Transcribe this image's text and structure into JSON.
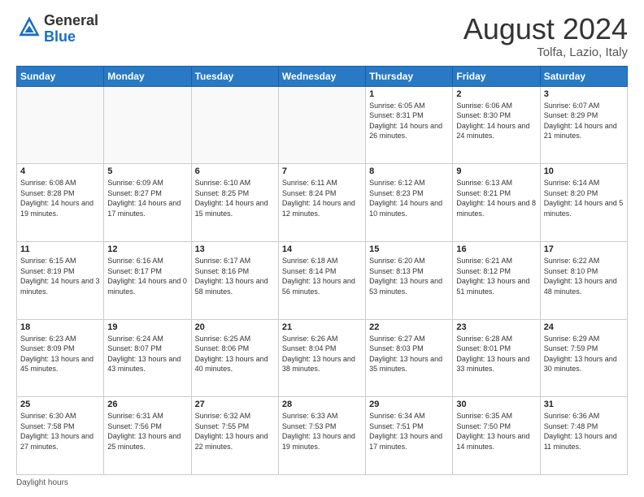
{
  "header": {
    "logo_general": "General",
    "logo_blue": "Blue",
    "title": "August 2024",
    "location": "Tolfa, Lazio, Italy"
  },
  "days_of_week": [
    "Sunday",
    "Monday",
    "Tuesday",
    "Wednesday",
    "Thursday",
    "Friday",
    "Saturday"
  ],
  "weeks": [
    [
      {
        "day": "",
        "detail": ""
      },
      {
        "day": "",
        "detail": ""
      },
      {
        "day": "",
        "detail": ""
      },
      {
        "day": "",
        "detail": ""
      },
      {
        "day": "1",
        "detail": "Sunrise: 6:05 AM\nSunset: 8:31 PM\nDaylight: 14 hours and 26 minutes."
      },
      {
        "day": "2",
        "detail": "Sunrise: 6:06 AM\nSunset: 8:30 PM\nDaylight: 14 hours and 24 minutes."
      },
      {
        "day": "3",
        "detail": "Sunrise: 6:07 AM\nSunset: 8:29 PM\nDaylight: 14 hours and 21 minutes."
      }
    ],
    [
      {
        "day": "4",
        "detail": "Sunrise: 6:08 AM\nSunset: 8:28 PM\nDaylight: 14 hours and 19 minutes."
      },
      {
        "day": "5",
        "detail": "Sunrise: 6:09 AM\nSunset: 8:27 PM\nDaylight: 14 hours and 17 minutes."
      },
      {
        "day": "6",
        "detail": "Sunrise: 6:10 AM\nSunset: 8:25 PM\nDaylight: 14 hours and 15 minutes."
      },
      {
        "day": "7",
        "detail": "Sunrise: 6:11 AM\nSunset: 8:24 PM\nDaylight: 14 hours and 12 minutes."
      },
      {
        "day": "8",
        "detail": "Sunrise: 6:12 AM\nSunset: 8:23 PM\nDaylight: 14 hours and 10 minutes."
      },
      {
        "day": "9",
        "detail": "Sunrise: 6:13 AM\nSunset: 8:21 PM\nDaylight: 14 hours and 8 minutes."
      },
      {
        "day": "10",
        "detail": "Sunrise: 6:14 AM\nSunset: 8:20 PM\nDaylight: 14 hours and 5 minutes."
      }
    ],
    [
      {
        "day": "11",
        "detail": "Sunrise: 6:15 AM\nSunset: 8:19 PM\nDaylight: 14 hours and 3 minutes."
      },
      {
        "day": "12",
        "detail": "Sunrise: 6:16 AM\nSunset: 8:17 PM\nDaylight: 14 hours and 0 minutes."
      },
      {
        "day": "13",
        "detail": "Sunrise: 6:17 AM\nSunset: 8:16 PM\nDaylight: 13 hours and 58 minutes."
      },
      {
        "day": "14",
        "detail": "Sunrise: 6:18 AM\nSunset: 8:14 PM\nDaylight: 13 hours and 56 minutes."
      },
      {
        "day": "15",
        "detail": "Sunrise: 6:20 AM\nSunset: 8:13 PM\nDaylight: 13 hours and 53 minutes."
      },
      {
        "day": "16",
        "detail": "Sunrise: 6:21 AM\nSunset: 8:12 PM\nDaylight: 13 hours and 51 minutes."
      },
      {
        "day": "17",
        "detail": "Sunrise: 6:22 AM\nSunset: 8:10 PM\nDaylight: 13 hours and 48 minutes."
      }
    ],
    [
      {
        "day": "18",
        "detail": "Sunrise: 6:23 AM\nSunset: 8:09 PM\nDaylight: 13 hours and 45 minutes."
      },
      {
        "day": "19",
        "detail": "Sunrise: 6:24 AM\nSunset: 8:07 PM\nDaylight: 13 hours and 43 minutes."
      },
      {
        "day": "20",
        "detail": "Sunrise: 6:25 AM\nSunset: 8:06 PM\nDaylight: 13 hours and 40 minutes."
      },
      {
        "day": "21",
        "detail": "Sunrise: 6:26 AM\nSunset: 8:04 PM\nDaylight: 13 hours and 38 minutes."
      },
      {
        "day": "22",
        "detail": "Sunrise: 6:27 AM\nSunset: 8:03 PM\nDaylight: 13 hours and 35 minutes."
      },
      {
        "day": "23",
        "detail": "Sunrise: 6:28 AM\nSunset: 8:01 PM\nDaylight: 13 hours and 33 minutes."
      },
      {
        "day": "24",
        "detail": "Sunrise: 6:29 AM\nSunset: 7:59 PM\nDaylight: 13 hours and 30 minutes."
      }
    ],
    [
      {
        "day": "25",
        "detail": "Sunrise: 6:30 AM\nSunset: 7:58 PM\nDaylight: 13 hours and 27 minutes."
      },
      {
        "day": "26",
        "detail": "Sunrise: 6:31 AM\nSunset: 7:56 PM\nDaylight: 13 hours and 25 minutes."
      },
      {
        "day": "27",
        "detail": "Sunrise: 6:32 AM\nSunset: 7:55 PM\nDaylight: 13 hours and 22 minutes."
      },
      {
        "day": "28",
        "detail": "Sunrise: 6:33 AM\nSunset: 7:53 PM\nDaylight: 13 hours and 19 minutes."
      },
      {
        "day": "29",
        "detail": "Sunrise: 6:34 AM\nSunset: 7:51 PM\nDaylight: 13 hours and 17 minutes."
      },
      {
        "day": "30",
        "detail": "Sunrise: 6:35 AM\nSunset: 7:50 PM\nDaylight: 13 hours and 14 minutes."
      },
      {
        "day": "31",
        "detail": "Sunrise: 6:36 AM\nSunset: 7:48 PM\nDaylight: 13 hours and 11 minutes."
      }
    ]
  ],
  "footer": {
    "daylight_label": "Daylight hours"
  }
}
